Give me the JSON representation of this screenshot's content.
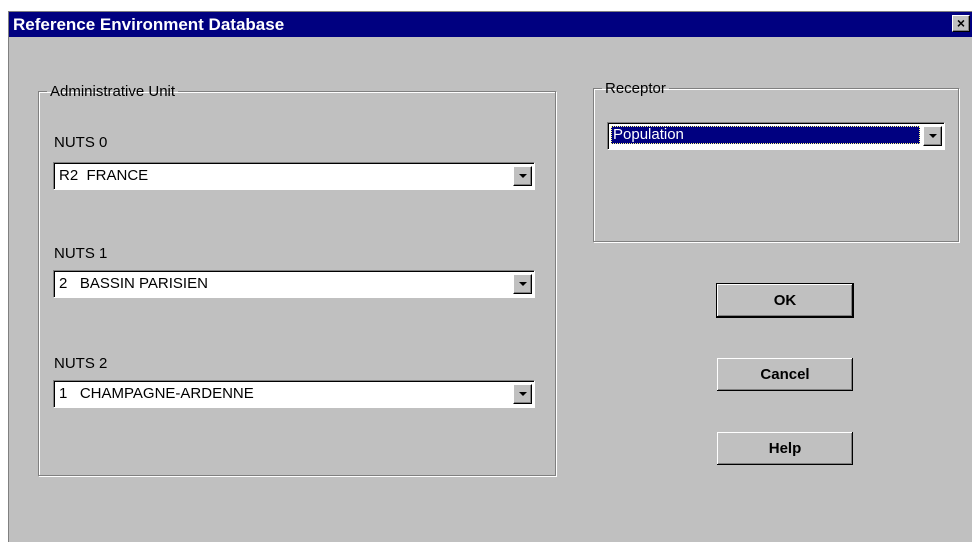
{
  "window": {
    "title": "Reference Environment Database",
    "close_glyph": "×"
  },
  "admin_unit": {
    "legend": "Administrative Unit",
    "nuts0": {
      "label": "NUTS 0",
      "value": "R2  FRANCE"
    },
    "nuts1": {
      "label": "NUTS 1",
      "value": "2   BASSIN PARISIEN"
    },
    "nuts2": {
      "label": "NUTS 2",
      "value": "1   CHAMPAGNE-ARDENNE"
    }
  },
  "receptor": {
    "legend": "Receptor",
    "value": "Population"
  },
  "buttons": {
    "ok": "OK",
    "cancel": "Cancel",
    "help": "Help"
  },
  "colors": {
    "titlebar": "#000080",
    "face": "#c0c0c0",
    "selection": "#000080"
  }
}
